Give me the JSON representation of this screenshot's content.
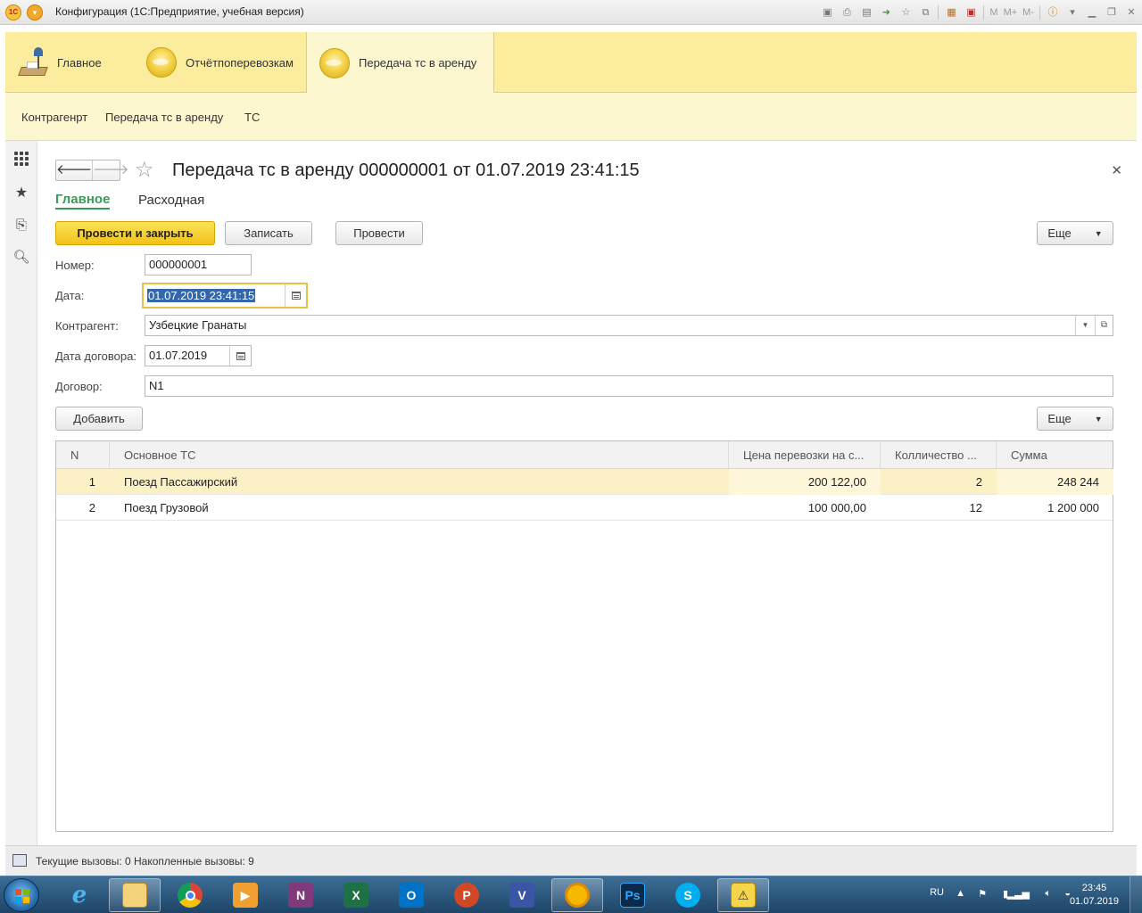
{
  "window": {
    "title": "Конфигурация  (1С:Предприятие, учебная версия)",
    "toolbar_text": {
      "m": "M",
      "m_plus": "M+",
      "m_minus": "M-"
    }
  },
  "sections": [
    {
      "label": "Главное",
      "icon": "desk-lamp-icon",
      "active": false
    },
    {
      "label": "Отчётпоперевозкам",
      "icon": "coin-icon",
      "active": false
    },
    {
      "label": "Передача тс в аренду",
      "icon": "coin-icon",
      "active": true
    }
  ],
  "functions": [
    "Контрагенрт",
    "Передача тс в аренду",
    "ТС"
  ],
  "document": {
    "title": "Передача тс в аренду 000000001 от 01.07.2019 23:41:15",
    "tabs": {
      "main": "Главное",
      "expense": "Расходная"
    },
    "buttons": {
      "post_close": "Провести и закрыть",
      "save": "Записать",
      "post": "Провести",
      "more": "Еще",
      "add": "Добавить",
      "more2": "Еще"
    },
    "fields": {
      "number_label": "Номер:",
      "number_value": "000000001",
      "date_label": "Дата:",
      "date_value": "01.07.2019 23:41:15",
      "counterparty_label": "Контрагент:",
      "counterparty_value": "Узбецкие Гранаты",
      "contract_date_label": "Дата договора:",
      "contract_date_value": "01.07.2019",
      "contract_label": "Договор:",
      "contract_value": "N1"
    },
    "table": {
      "columns": [
        "N",
        "Основное ТС",
        "Цена перевозки на с...",
        "Колличество ...",
        "Сумма"
      ],
      "rows": [
        {
          "n": "1",
          "vehicle": "Поезд Пассажирский",
          "price": "200 122,00",
          "qty": "2",
          "sum": "248 244",
          "selected": true
        },
        {
          "n": "2",
          "vehicle": "Поезд Грузовой",
          "price": "100 000,00",
          "qty": "12",
          "sum": "1 200 000",
          "selected": false
        }
      ]
    }
  },
  "statusbar": {
    "text": "Текущие вызовы: 0   Накопленные вызовы: 9"
  },
  "taskbar": {
    "apps": [
      "internet-explorer",
      "file-explorer",
      "chrome",
      "media-player",
      "onenote",
      "excel",
      "outlook",
      "powerpoint",
      "visio",
      "chrome-canary",
      "photoshop",
      "skype",
      "1c-enterprise"
    ],
    "language": "RU",
    "time": "23:45",
    "date": "01.07.2019"
  },
  "colors": {
    "section_bg": "#fbec9e",
    "function_bg": "#fdf7cf",
    "primary_button": "#f2c219",
    "active_tab": "#3a9a58",
    "selected_row": "#fcf1c4"
  }
}
